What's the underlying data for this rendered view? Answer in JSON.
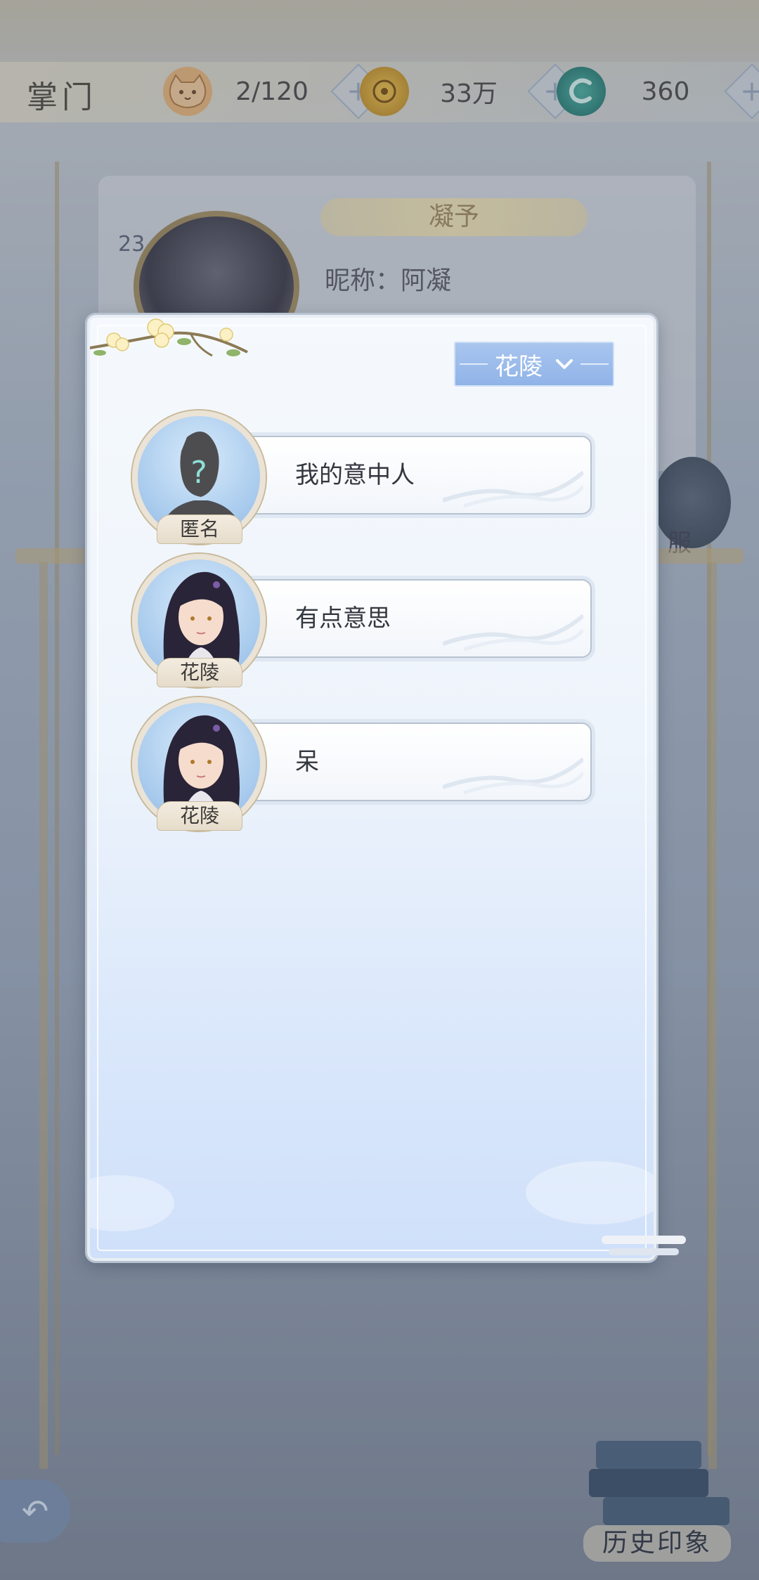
{
  "header": {
    "title": "掌门",
    "resources": [
      {
        "icon": "cat-face-icon",
        "value": "2/120"
      },
      {
        "icon": "gold-coin-icon",
        "value": "33万"
      },
      {
        "icon": "jade-dragon-icon",
        "value": "360"
      }
    ]
  },
  "profile": {
    "title_tag": "凝予",
    "nickname_line": "昵称：阿凝",
    "level": "23",
    "side_button_label": "服"
  },
  "modal": {
    "filter": {
      "selected": "花陵"
    },
    "entries": [
      {
        "avatar_label": "匿名",
        "text": "我的意中人",
        "anonymous": true
      },
      {
        "avatar_label": "花陵",
        "text": "有点意思",
        "anonymous": false
      },
      {
        "avatar_label": "花陵",
        "text": "呆",
        "anonymous": false
      }
    ]
  },
  "footer": {
    "history_label": "历史印象"
  },
  "colors": {
    "dropdown": "#9bbbeb",
    "modal_bottom": "#cfe0fa",
    "text": "#33373f"
  }
}
